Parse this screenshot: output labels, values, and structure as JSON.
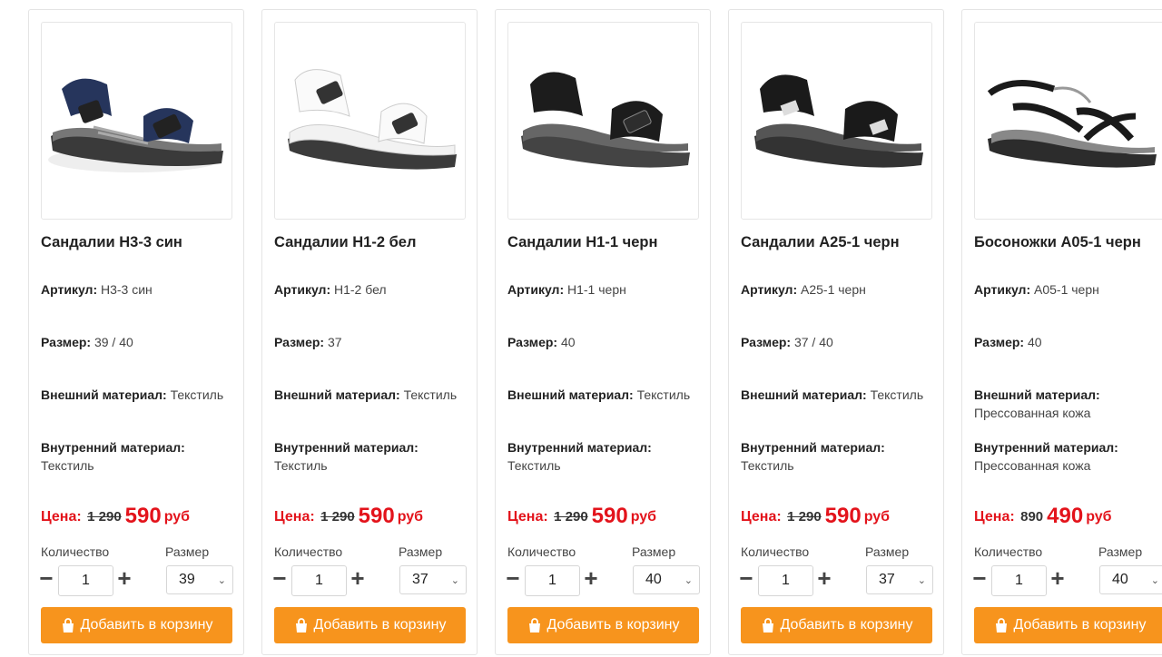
{
  "labels": {
    "article": "Артикул:",
    "size": "Размер:",
    "outer": "Внешний материал:",
    "inner": "Внутренний материал:",
    "price": "Цена:",
    "currency": "руб",
    "quantity": "Количество",
    "size_select": "Размер",
    "add_to_cart": "Добавить в корзину"
  },
  "colors": {
    "accent": "#f7941d",
    "price": "#e3131b"
  },
  "products": [
    {
      "name": "Сандалии Н3-3 син",
      "article": "Н3-3 син",
      "size": "39 / 40",
      "outer": "Текстиль",
      "inner": "Текстиль",
      "old_price": "1 290",
      "new_price": "590",
      "qty": "1",
      "selected_size": "39",
      "image": "navy-sandal"
    },
    {
      "name": "Сандалии Н1-2 бел",
      "article": "Н1-2 бел",
      "size": "37",
      "outer": "Текстиль",
      "inner": "Текстиль",
      "old_price": "1 290",
      "new_price": "590",
      "qty": "1",
      "selected_size": "37",
      "image": "white-sandal"
    },
    {
      "name": "Сандалии Н1-1 черн",
      "article": "Н1-1 черн",
      "size": "40",
      "outer": "Текстиль",
      "inner": "Текстиль",
      "old_price": "1 290",
      "new_price": "590",
      "qty": "1",
      "selected_size": "40",
      "image": "black-sandal"
    },
    {
      "name": "Сандалии А25-1 черн",
      "article": "А25-1 черн",
      "size": "37 / 40",
      "outer": "Текстиль",
      "inner": "Текстиль",
      "old_price": "1 290",
      "new_price": "590",
      "qty": "1",
      "selected_size": "37",
      "image": "black-sandal-2"
    },
    {
      "name": "Босоножки А05-1 черн",
      "article": "А05-1 черн",
      "size": "40",
      "outer": "Прессованная кожа",
      "inner": "Прессованная кожа",
      "old_price": "890",
      "new_price": "490",
      "qty": "1",
      "selected_size": "40",
      "image": "black-strappy-sandal"
    }
  ]
}
